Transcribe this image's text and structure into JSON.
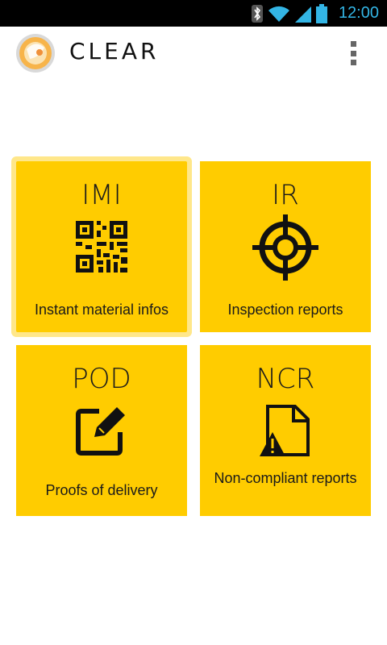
{
  "status_bar": {
    "time": "12:00",
    "icons": [
      "bluetooth-icon",
      "wifi-icon",
      "signal-icon",
      "battery-icon"
    ],
    "accent": "#33b5e5"
  },
  "action_bar": {
    "title": "CLEAR",
    "logo": "clear-app-logo",
    "menu_icon": "overflow-menu-icon"
  },
  "tiles": [
    {
      "code": "IMI",
      "label": "Instant material infos",
      "icon": "qr-code-icon",
      "selected": true
    },
    {
      "code": "IR",
      "label": "Inspection reports",
      "icon": "crosshair-target-icon",
      "selected": false
    },
    {
      "code": "POD",
      "label": "Proofs of delivery",
      "icon": "edit-signature-icon",
      "selected": false
    },
    {
      "code": "NCR",
      "label": "Non-compliant reports",
      "icon": "document-warning-icon",
      "selected": false
    }
  ],
  "colors": {
    "tile": "#ffcc00",
    "tile_selected_glow": "#ffe78a",
    "background": "#ffffff",
    "text": "#1a1a1a"
  }
}
